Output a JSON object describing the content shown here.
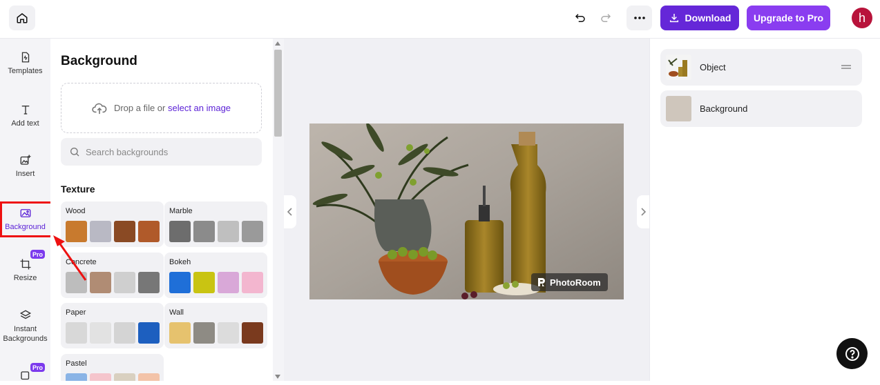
{
  "header": {
    "home_icon": "home-icon",
    "undo_icon": "undo-icon",
    "redo_icon": "redo-icon",
    "more_icon": "more-dots-icon",
    "download_label": "Download",
    "upgrade_label": "Upgrade to Pro",
    "avatar_initial": "h"
  },
  "rail": {
    "items": [
      {
        "label": "Templates",
        "icon": "templates-icon"
      },
      {
        "label": "Add text",
        "icon": "text-icon"
      },
      {
        "label": "Insert",
        "icon": "insert-image-icon"
      },
      {
        "label": "Background",
        "icon": "background-icon",
        "active": true
      },
      {
        "label": "Resize",
        "icon": "crop-icon",
        "badge": "Pro"
      },
      {
        "label": "Instant\nBackgrounds",
        "icon": "layers-icon"
      },
      {
        "label": "",
        "icon": "frame-icon",
        "badge": "Pro"
      }
    ]
  },
  "panel": {
    "title": "Background",
    "drop_text": "Drop a file or ",
    "drop_link": "select an image",
    "search_placeholder": "Search backgrounds",
    "section": "Texture",
    "categories": [
      {
        "name": "Wood",
        "colors": [
          "#c87a2e",
          "#b9b9c4",
          "#8a4a24",
          "#b05a2a"
        ]
      },
      {
        "name": "Marble",
        "colors": [
          "#6d6d6d",
          "#8b8b8b",
          "#bfbfbf",
          "#9a9a9a"
        ]
      },
      {
        "name": "Concrete",
        "colors": [
          "#bdbdbd",
          "#b08c74",
          "#cfcfcf",
          "#777777"
        ]
      },
      {
        "name": "Bokeh",
        "colors": [
          "#1f6fd8",
          "#c9c412",
          "#d9a8d8",
          "#f3b6cf"
        ]
      },
      {
        "name": "Paper",
        "colors": [
          "#d8d8d8",
          "#e2e2e2",
          "#d4d4d4",
          "#1d5fbf"
        ]
      },
      {
        "name": "Wall",
        "colors": [
          "#e6c26e",
          "#8e8b84",
          "#dcdcdc",
          "#7a3a1e"
        ]
      },
      {
        "name": "Pastel",
        "colors": [
          "#8ab4e6",
          "#f5c5cc",
          "#d9d0c0",
          "#f3c3a8"
        ]
      }
    ]
  },
  "canvas": {
    "watermark": "PhotoRoom"
  },
  "layers": [
    {
      "name": "Object"
    },
    {
      "name": "Background"
    }
  ],
  "colors": {
    "accent": "#6527d8",
    "upgrade": "#8a3df0",
    "highlight": "#ee1111"
  }
}
